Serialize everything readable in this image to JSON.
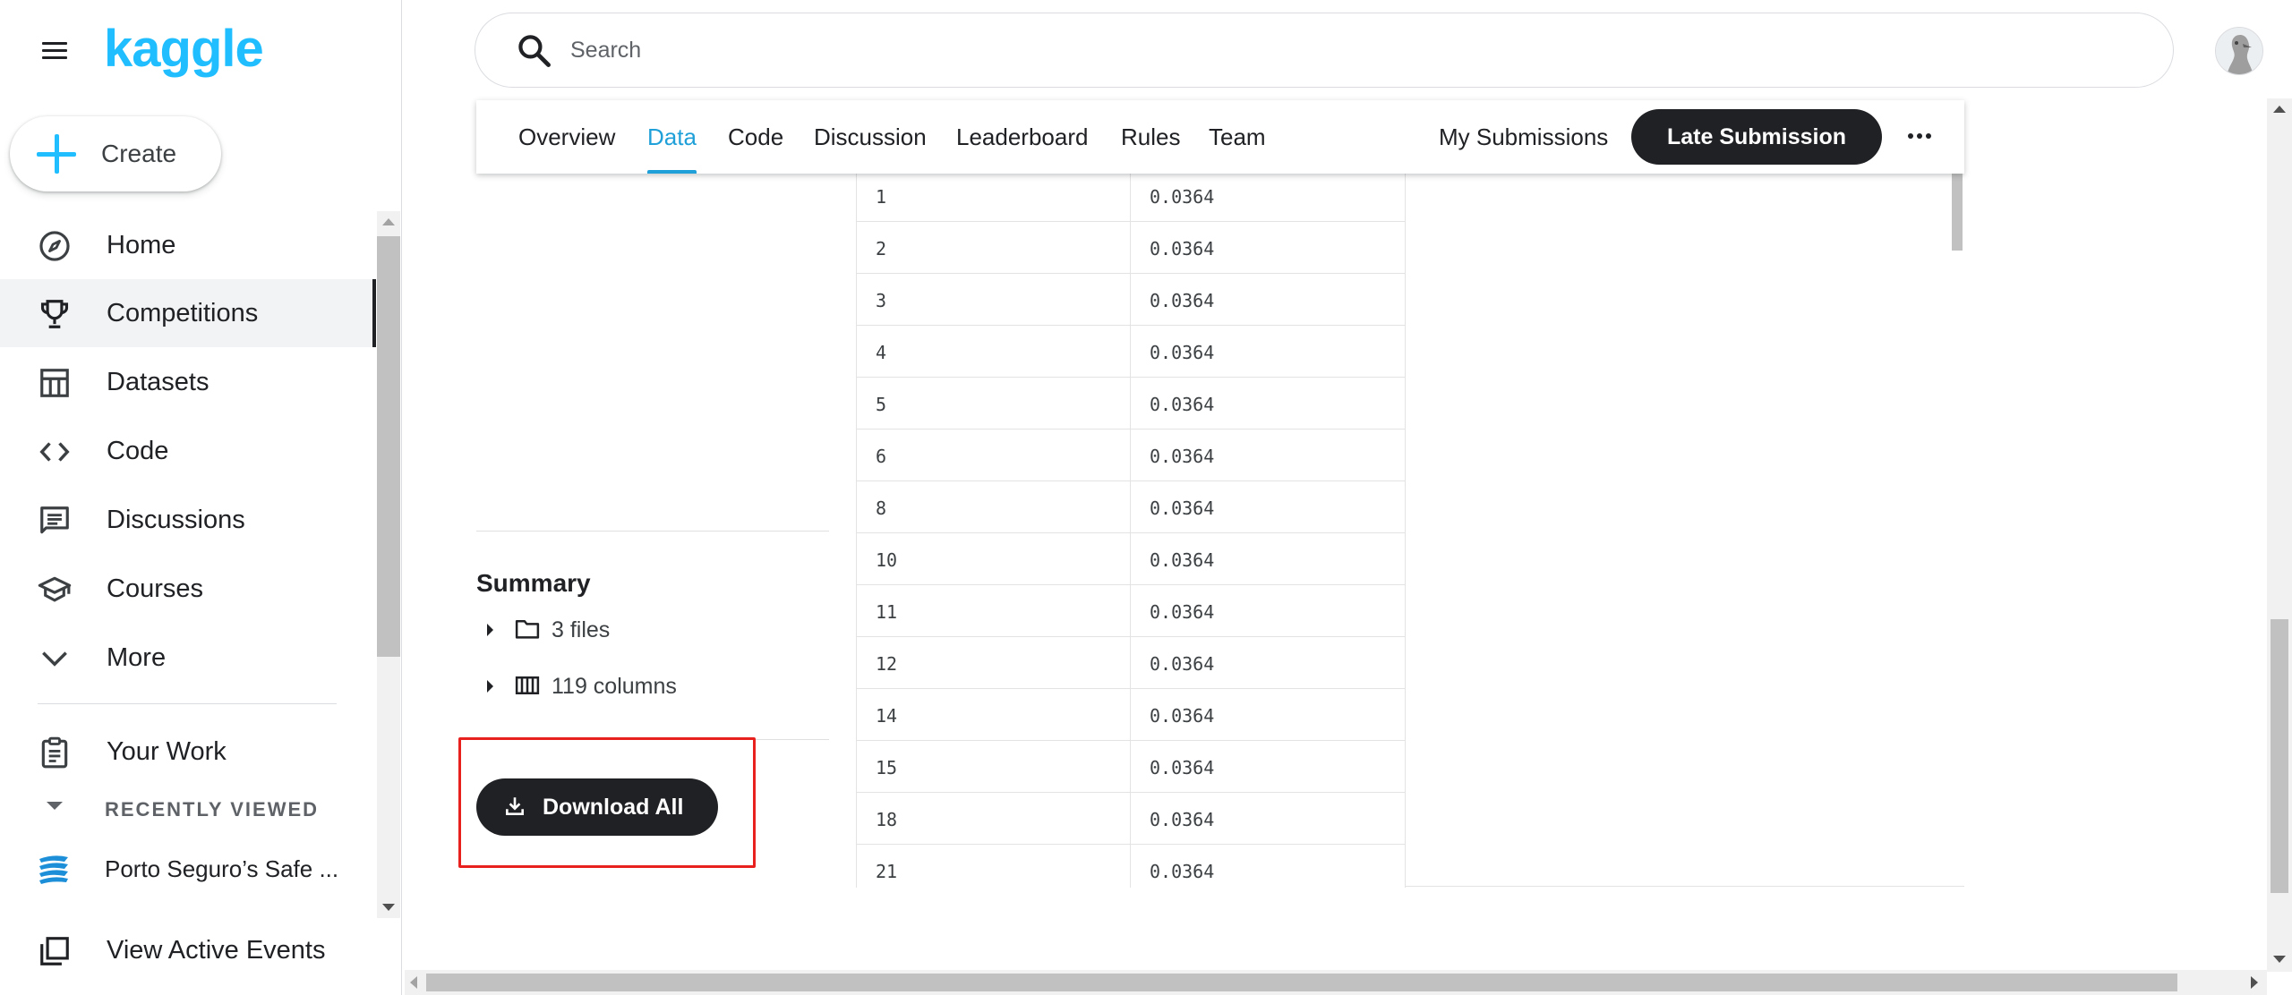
{
  "app": {
    "logo": "kaggle"
  },
  "sidebar": {
    "create_label": "Create",
    "items": [
      {
        "label": "Home",
        "icon": "compass-icon"
      },
      {
        "label": "Competitions",
        "icon": "trophy-icon",
        "active": true
      },
      {
        "label": "Datasets",
        "icon": "table-icon"
      },
      {
        "label": "Code",
        "icon": "code-icon"
      },
      {
        "label": "Discussions",
        "icon": "comment-icon"
      },
      {
        "label": "Courses",
        "icon": "school-icon"
      },
      {
        "label": "More",
        "icon": "chevron-down-icon"
      }
    ],
    "your_work": "Your Work",
    "recently_viewed": "RECENTLY VIEWED",
    "recent_items": [
      {
        "label": "Porto Seguro’s Safe ..."
      }
    ],
    "view_events": "View Active Events"
  },
  "search": {
    "placeholder": "Search"
  },
  "tabs": {
    "items": [
      "Overview",
      "Data",
      "Code",
      "Discussion",
      "Leaderboard",
      "Rules",
      "Team"
    ],
    "active": "Data",
    "my_submissions": "My Submissions",
    "late_submission": "Late Submission"
  },
  "summary": {
    "title": "Summary",
    "files": "3 files",
    "columns": "119 columns",
    "download_all": "Download All"
  },
  "table": {
    "rows": [
      [
        "1",
        "0.0364"
      ],
      [
        "2",
        "0.0364"
      ],
      [
        "3",
        "0.0364"
      ],
      [
        "4",
        "0.0364"
      ],
      [
        "5",
        "0.0364"
      ],
      [
        "6",
        "0.0364"
      ],
      [
        "8",
        "0.0364"
      ],
      [
        "10",
        "0.0364"
      ],
      [
        "11",
        "0.0364"
      ],
      [
        "12",
        "0.0364"
      ],
      [
        "14",
        "0.0364"
      ],
      [
        "15",
        "0.0364"
      ],
      [
        "18",
        "0.0364"
      ],
      [
        "21",
        "0.0364"
      ]
    ]
  },
  "colors": {
    "accent": "#20beff",
    "tab_active": "#20a0d8",
    "highlight": "#e8201e",
    "dark_button": "#202124"
  }
}
